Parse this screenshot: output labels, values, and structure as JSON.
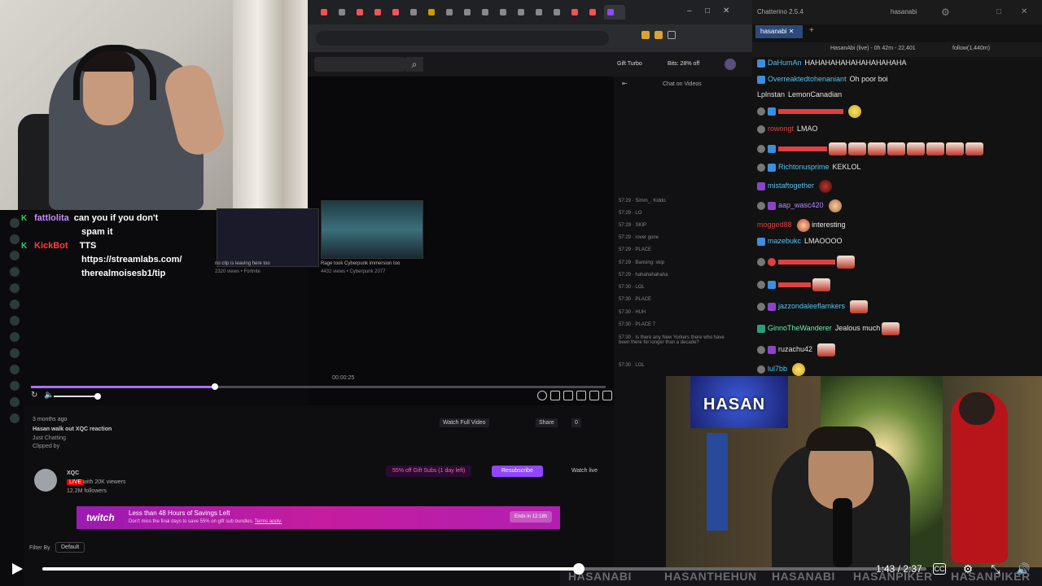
{
  "overlay_chat": [
    {
      "badge": "K",
      "name": "fattlolita",
      "name_color": "#c78bff",
      "line1": "can you if you don't",
      "line2": "spam it"
    },
    {
      "badge": "K",
      "name": "KickBot",
      "name_color": "#ff3b3b",
      "line1": "TTS",
      "line2": "https://streamlabs.com/",
      "line3": "therealmoisesb1/tip"
    }
  ],
  "browser": {
    "twitch": {
      "gift_turbo": "Gift Turbo",
      "bits": "Bits: 28% off",
      "chat_on_videos": "Chat on Videos"
    },
    "video": {
      "time": "00:00:25",
      "title": "Hasan walk out XQC reaction",
      "age": "3 months ago",
      "category": "Just Chatting",
      "clipped_by": "Clipped by",
      "watch_full": "Watch Full Video",
      "share": "Share",
      "likes": "0",
      "thumb1_title": "no clip is leaving here too",
      "thumb1_meta": "2320 views • Fortnite",
      "thumb2_title": "Rage took Cyberpunk immersion too",
      "thumb2_meta": "4432 views • Cyberpunk 2077"
    },
    "channel": {
      "name": "XQC",
      "live": "LIVE",
      "viewers": "with 20K viewers",
      "followers": "12.2M followers",
      "sub_offer": "55% off Gift Subs (1 day left)",
      "resubscribe": "Resubscribe",
      "watch_live": "Watch live"
    },
    "promo": {
      "logo": "twitch",
      "headline": "Less than 48 Hours of Savings Left",
      "sub": "Don't miss the final days to save 55% on gift sub bundles.",
      "terms": "Terms apply.",
      "button": "Ends in 12:18h"
    },
    "filter": {
      "label": "Filter By",
      "value": "Default"
    }
  },
  "side_chat": [
    {
      "t": "57:29",
      "txt": "Simm_. Kiddo"
    },
    {
      "t": "57:29",
      "txt": "LO"
    },
    {
      "t": "57:29",
      "txt": "SKIP"
    },
    {
      "t": "57:29",
      "txt": "rover gone"
    },
    {
      "t": "57:29",
      "txt": "PLACE"
    },
    {
      "t": "57:29",
      "txt": "Bansing: skip"
    },
    {
      "t": "57:29",
      "txt": "hahahahahaha"
    },
    {
      "t": "57:30",
      "txt": "LOL"
    },
    {
      "t": "57:30",
      "txt": "PLACE"
    },
    {
      "t": "57:30",
      "txt": "HUH"
    },
    {
      "t": "57:30",
      "txt": "PLACE 7"
    },
    {
      "t": "57:30",
      "txt": "Is there any New Yorkers there who have been there for longer than a decade?"
    },
    {
      "t": "57:30",
      "txt": "LOL"
    }
  ],
  "chatterino": {
    "title": "Chatterino 2.5.4",
    "user": "hasanabi",
    "tab": "hasanabi",
    "status": "HasanAbi (live) - 0h 42m - 22,401",
    "follow": "follow(1,440m)",
    "messages": [
      {
        "name": "DaHumAn",
        "color": "#4fc3f7",
        "text": "HAHAHAHAHAHAHAHAHAHA",
        "emotes": 0
      },
      {
        "name": "Overreaktedtohenaniant",
        "color": "#4fc3f7",
        "text": "Oh poor boi",
        "emotes": 0
      },
      {
        "name": "Lplnstan",
        "color": "#e0e0e0",
        "text": "LemonCanadian",
        "emotes": 0
      },
      {
        "name": "",
        "color": "#e04040",
        "text": "",
        "emotes": 1,
        "yellow": true
      },
      {
        "name": "rowongt",
        "color": "#e04040",
        "text": "LMAO",
        "emotes": 0
      },
      {
        "name": "",
        "color": "#e04040",
        "text": "",
        "emotes": 8
      },
      {
        "name": "Richtonusprime",
        "color": "#4fc3f7",
        "text": "KEKLOL",
        "emotes": 0
      },
      {
        "name": "mistaftogether",
        "color": "#4fc3f7",
        "text": "",
        "emotes": 1
      },
      {
        "name": "aap_wasc420",
        "color": "#b388ff",
        "text": "",
        "emotes": 1
      },
      {
        "name": "mogged88",
        "color": "#e04040",
        "text": "interesting",
        "emotes": 1
      },
      {
        "name": "mazebukc",
        "color": "#4fc3f7",
        "text": "LMAOOOO",
        "emotes": 0
      },
      {
        "name": "",
        "color": "#e04040",
        "text": "",
        "emotes": 1
      },
      {
        "name": "",
        "color": "#e04040",
        "text": "",
        "emotes": 1
      },
      {
        "name": "jazzondaleeflamkers",
        "color": "#4fc3f7",
        "text": "",
        "emotes": 1
      },
      {
        "name": "GinnoTheWanderer",
        "color": "#69f0ae",
        "text": "Jealous much",
        "emotes": 1
      },
      {
        "name": "ruzachu42",
        "color": "#e0e0e0",
        "text": "",
        "emotes": 1
      },
      {
        "name": "lul7bb",
        "color": "#4fc3f7",
        "text": "",
        "emotes": 1,
        "yellow": true
      }
    ]
  },
  "cam2": {
    "banner": "HASAN"
  },
  "ticker": [
    "HASANABI",
    "HASANTHEHUN",
    "HASANABI",
    "HASANPIKER",
    "HASANPIKER"
  ],
  "player": {
    "current": "1:43",
    "total": "2:37",
    "progress": 0.607
  }
}
